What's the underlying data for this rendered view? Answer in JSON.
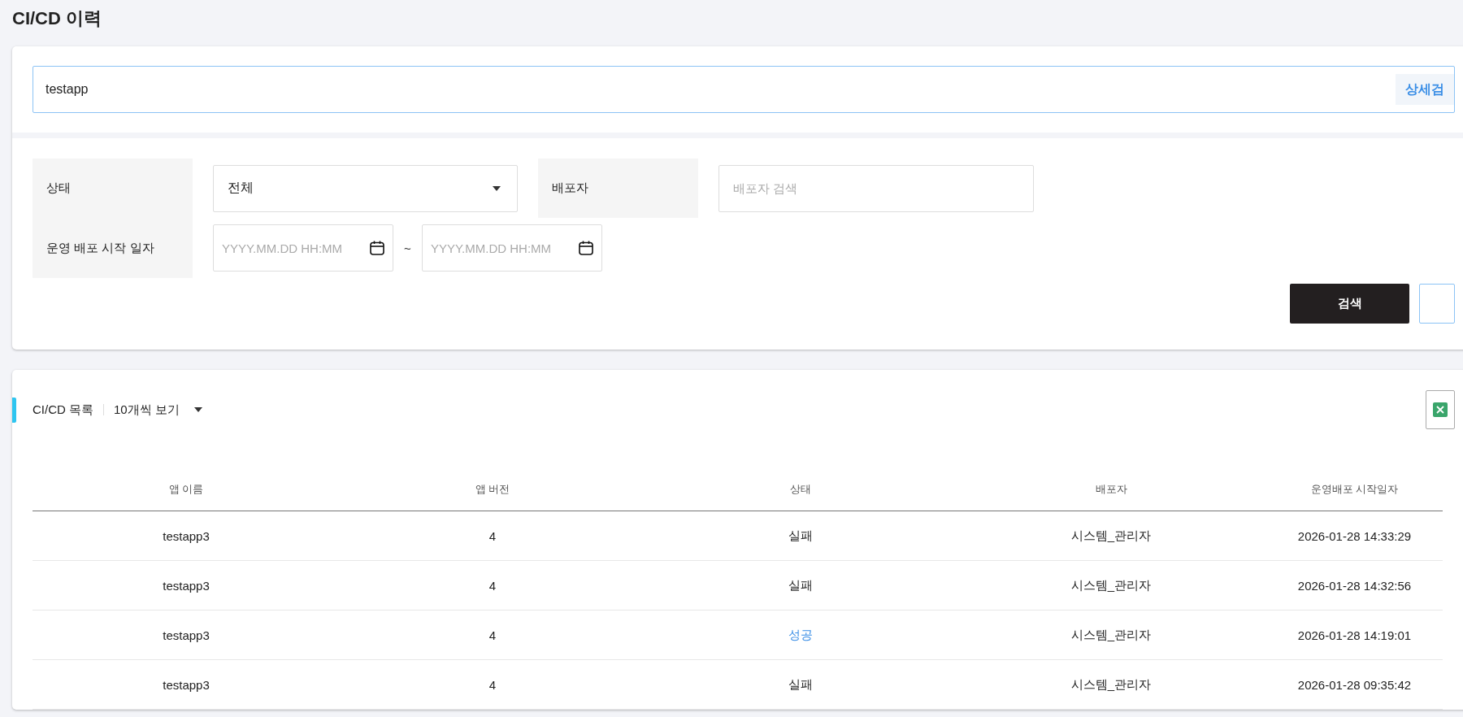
{
  "page": {
    "title": "CI/CD 이력"
  },
  "search": {
    "value": "testapp",
    "focused": true,
    "detail_button": "상세검"
  },
  "filters": {
    "status": {
      "label": "상태",
      "value": "전체"
    },
    "deployer": {
      "label": "배포자",
      "placeholder": "배포자 검색"
    },
    "start_date": {
      "label": "운영 배포 시작 일자",
      "from_placeholder": "YYYY.MM.DD HH:MM",
      "separator": "~",
      "to_placeholder": "YYYY.MM.DD HH:MM"
    },
    "buttons": [
      {
        "label": "검색",
        "kind": "primary"
      },
      {
        "kind": "outline"
      }
    ]
  },
  "list": {
    "title": "CI/CD 목록",
    "page_size": "10개씩 보기",
    "columns": [
      "앱 이름",
      "앱 버전",
      "상태",
      "배포자",
      "운영배포 시작일자"
    ],
    "rows": [
      {
        "app_name": "testapp3",
        "version": "4",
        "status": {
          "text": "실패",
          "color": "#222222"
        },
        "deployer": "시스템_관리자",
        "started_at": "2026-01-28 14:33:29"
      },
      {
        "app_name": "testapp3",
        "version": "4",
        "status": {
          "text": "실패",
          "color": "#222222"
        },
        "deployer": "시스템_관리자",
        "started_at": "2026-01-28 14:32:56"
      },
      {
        "app_name": "testapp3",
        "version": "4",
        "status": {
          "text": "성공",
          "color": "#3a8ee6"
        },
        "deployer": "시스템_관리자",
        "started_at": "2026-01-28 14:19:01"
      },
      {
        "app_name": "testapp3",
        "version": "4",
        "status": {
          "text": "실패",
          "color": "#222222"
        },
        "deployer": "시스템_관리자",
        "started_at": "2026-01-28 09:35:42"
      }
    ]
  }
}
